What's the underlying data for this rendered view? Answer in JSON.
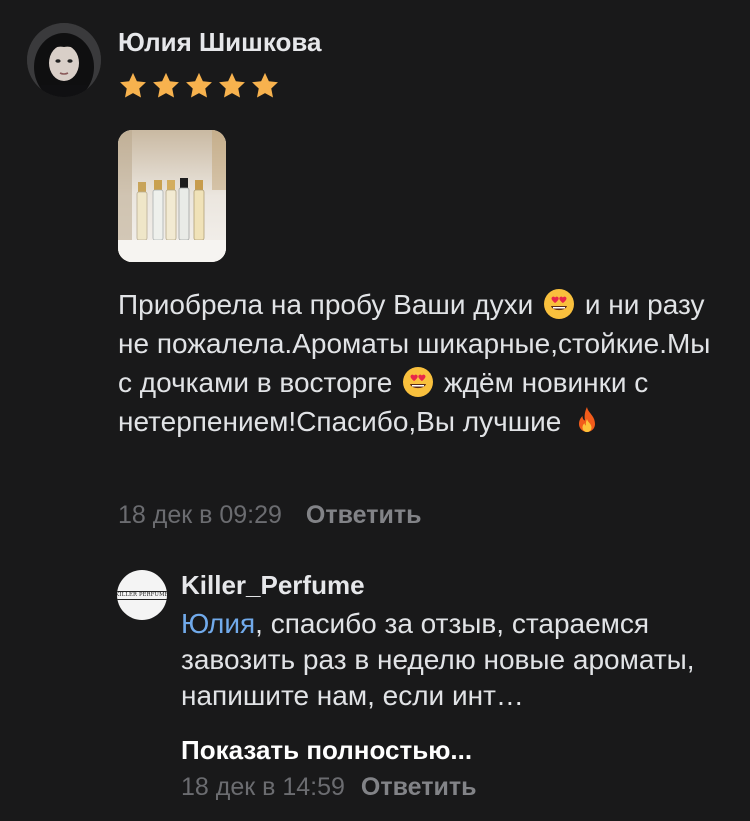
{
  "review": {
    "author": "Юлия Шишкова",
    "rating": 5,
    "text_parts": [
      "Приобрела на пробу Ваши духи",
      "и ни разу не пожалела.Ароматы шикарные,стойкие.Мы с дочками в восторге",
      "ждём новинки с нетерпением!Спасибо,Вы лучшие"
    ],
    "emoji_names": [
      "heart-eyes-emoji",
      "heart-eyes-emoji",
      "fire-emoji"
    ],
    "date": "18 дек в 09:29",
    "reply_label": "Ответить"
  },
  "shop_reply": {
    "author": "Killer_Perfume",
    "logo_text": "KILLER PERFUME",
    "mention": "Юлия",
    "text": ", спасибо за отзыв, стараемся завозить раз в неделю новые ароматы, напишите нам, если инт…",
    "show_more_label": "Показать полностью...",
    "date": "18 дек в 14:59",
    "reply_label": "Ответить"
  },
  "colors": {
    "background": "#19191a",
    "text": "#e1e3e6",
    "secondary": "#6b6c70",
    "link": "#71aaeb",
    "star": "#f7b24e"
  }
}
